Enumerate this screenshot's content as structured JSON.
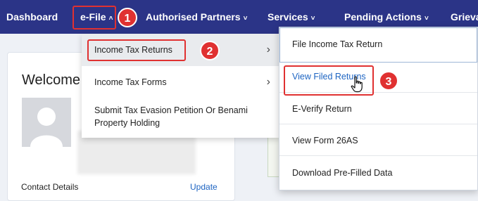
{
  "navbar": {
    "items": [
      {
        "label": "Dashboard"
      },
      {
        "label": "e-File",
        "caret": "^"
      },
      {
        "label": "Authorised Partners",
        "caret": "⌄"
      },
      {
        "label": "Services",
        "caret": "⌄"
      },
      {
        "label": "Pending Actions",
        "caret": "⌄"
      },
      {
        "label": "Grievan"
      }
    ],
    "background_color": "#2b3487"
  },
  "background": {
    "welcome_text": "Welcome E",
    "contact_label": "Contact Details",
    "update_link": "Update"
  },
  "efile_menu": {
    "items": [
      {
        "label": "Income Tax Returns",
        "has_submenu": true
      },
      {
        "label": "Income Tax Forms",
        "has_submenu": true
      },
      {
        "label": "Submit Tax Evasion Petition Or Benami Property Holding",
        "line1": "Submit Tax Evasion Petition Or Benami",
        "line2": "Property Holding"
      }
    ]
  },
  "itr_submenu": {
    "items": [
      {
        "label": "File Income Tax Return"
      },
      {
        "label": "View Filed Returns"
      },
      {
        "label": "E-Verify Return"
      },
      {
        "label": "View Form 26AS"
      },
      {
        "label": "Download Pre-Filled Data"
      }
    ]
  },
  "step_markers": [
    "1",
    "2",
    "3"
  ],
  "colors": {
    "highlight": "#e03131",
    "link": "#1d64c2",
    "nav": "#2b3487"
  }
}
